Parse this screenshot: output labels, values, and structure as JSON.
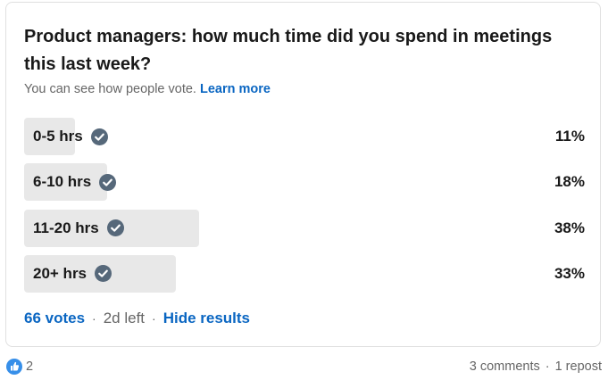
{
  "poll": {
    "question": "Product managers: how much time did you spend in meetings this last week?",
    "visibility_note": "You can see how people vote.",
    "learn_more": "Learn more",
    "options": [
      {
        "label": "0-5 hrs",
        "percent": "11%",
        "fraction": 0.11
      },
      {
        "label": "6-10 hrs",
        "percent": "18%",
        "fraction": 0.18
      },
      {
        "label": "11-20 hrs",
        "percent": "38%",
        "fraction": 0.38
      },
      {
        "label": "20+ hrs",
        "percent": "33%",
        "fraction": 0.33
      }
    ],
    "votes": "66 votes",
    "time_left": "2d left",
    "hide_results": "Hide results",
    "separator": "·"
  },
  "social": {
    "reaction_count": "2",
    "comments": "3 comments",
    "reposts": "1 repost",
    "separator": "·"
  },
  "colors": {
    "accent": "#0a66c2",
    "bar": "#e8e8e8",
    "check": "#56687a",
    "muted": "#666666"
  },
  "icons": {
    "option_check": "check-circle-icon",
    "reaction": "like-icon"
  }
}
